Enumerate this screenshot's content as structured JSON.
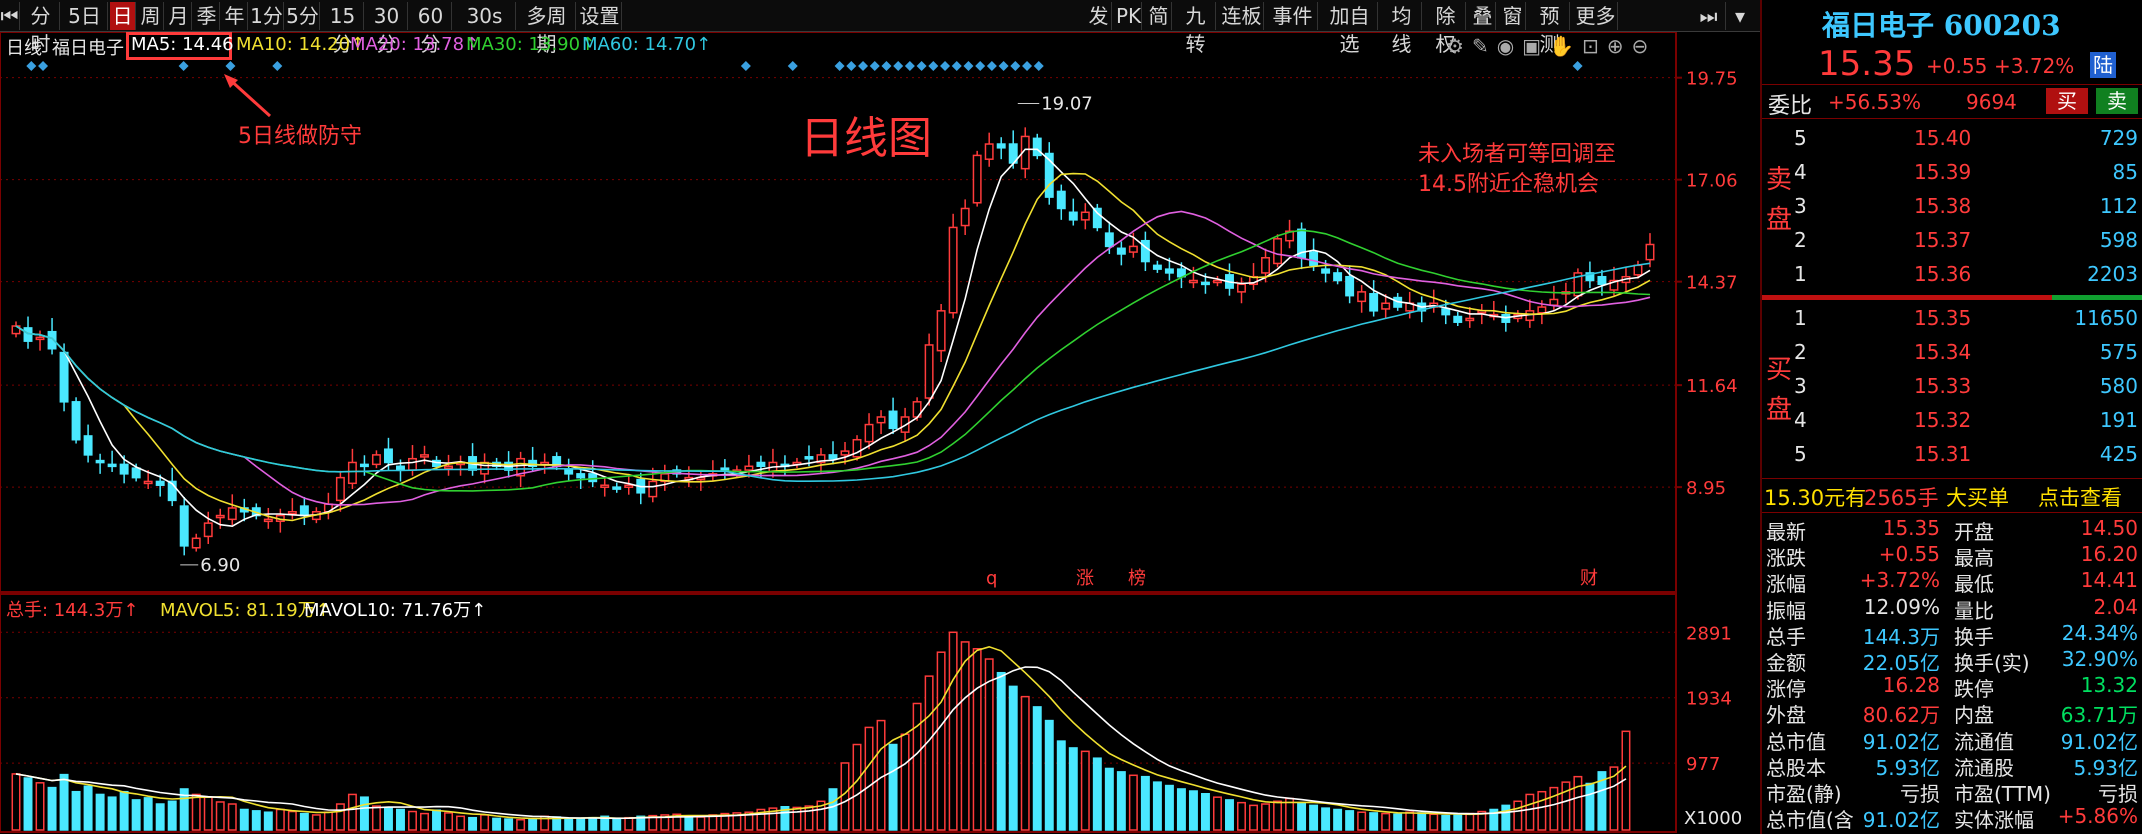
{
  "toolbar": {
    "left_items": [
      "分时",
      "5日",
      "日",
      "周",
      "月",
      "季",
      "年",
      "1分",
      "5分",
      "15分",
      "30分",
      "60分",
      "30s",
      "多周期",
      "设置"
    ],
    "active_item": "日",
    "right_items": [
      "发",
      "PK",
      "简",
      "九转",
      "连板",
      "事件",
      "加自选",
      "均线",
      "除权",
      "叠",
      "窗",
      "预测",
      "更多"
    ]
  },
  "legend": {
    "period": "日线",
    "stock": "福日电子",
    "ma5": "MA5: 14.46",
    "ma10": "MA10: 14.20↑",
    "ma20": "MA20: 13.78↑",
    "ma30": "MA30: 13.90↑",
    "ma60": "MA60: 14.70↑"
  },
  "annotations": {
    "ma5_note": "5日线做防守",
    "chart_title": "日线图",
    "note_line1": "未入场者可等回调至",
    "note_line2": "14.5附近企稳机会",
    "high_label": "19.07",
    "low_label": "6.90",
    "event_q": "q",
    "event_zhang": "涨",
    "event_bang": "榜",
    "event_cai": "财"
  },
  "volume_legend": {
    "total": "总手: 144.3万↑",
    "mavol5": "MAVOL5: 81.19万↑",
    "mavol10": "MAVOL10: 71.76万↑",
    "unit": "X1000"
  },
  "colors": {
    "up": "#ff3b3b",
    "down": "#4ae8ff",
    "ma5": "#ffffff",
    "ma10": "#f0e030",
    "ma20": "#e060e0",
    "ma30": "#30d030",
    "ma60": "#30c8e0",
    "background": "#000000",
    "grid": "#7a0000"
  },
  "chart_data": {
    "type": "candlestick",
    "price_axis_ticks": [
      "19.75",
      "17.06",
      "14.37",
      "11.64",
      "8.95"
    ],
    "volume_axis_ticks": [
      "2891",
      "1934",
      "977"
    ],
    "price_range": [
      6.5,
      19.9
    ],
    "volume_range": [
      0,
      3100
    ],
    "high": 19.07,
    "low": 6.9,
    "close_series": [
      13.2,
      12.8,
      12.9,
      12.6,
      11.2,
      10.2,
      9.8,
      9.6,
      9.5,
      9.3,
      9.2,
      9.1,
      9.0,
      8.6,
      7.4,
      7.6,
      8.0,
      8.2,
      8.4,
      8.3,
      8.2,
      8.1,
      8.2,
      8.3,
      8.2,
      8.3,
      8.5,
      9.2,
      9.6,
      9.5,
      9.8,
      9.6,
      9.4,
      9.7,
      9.8,
      9.5,
      9.5,
      9.6,
      9.4,
      9.6,
      9.5,
      9.4,
      9.7,
      9.5,
      9.6,
      9.5,
      9.3,
      9.2,
      9.1,
      9.0,
      8.9,
      9.0,
      8.8,
      9.1,
      9.3,
      9.3,
      9.2,
      9.2,
      9.3,
      9.4,
      9.4,
      9.5,
      9.5,
      9.6,
      9.5,
      9.6,
      9.7,
      9.8,
      9.7,
      9.9,
      10.2,
      10.6,
      10.8,
      10.5,
      10.8,
      11.2,
      12.7,
      13.6,
      15.8,
      16.3,
      17.7,
      18.0,
      17.9,
      17.5,
      18.2,
      17.7,
      16.6,
      16.3,
      16.0,
      16.2,
      15.8,
      15.3,
      15.1,
      15.3,
      14.9,
      14.7,
      14.6,
      14.5,
      14.4,
      14.3,
      14.4,
      14.2,
      14.3,
      14.5,
      15.0,
      15.5,
      15.7,
      15.0,
      14.8,
      14.6,
      14.4,
      14.0,
      14.1,
      13.6,
      13.8,
      13.7,
      13.8,
      13.6,
      13.8,
      13.5,
      13.3,
      13.4,
      13.6,
      13.5,
      13.3,
      13.5,
      13.6,
      13.7,
      13.9,
      14.1,
      14.6,
      14.4,
      14.3,
      14.4,
      14.5,
      14.8,
      15.35
    ],
    "volume_series": [
      820,
      760,
      690,
      620,
      810,
      560,
      640,
      520,
      480,
      560,
      440,
      470,
      380,
      420,
      600,
      520,
      480,
      410,
      380,
      300,
      280,
      260,
      300,
      270,
      240,
      220,
      260,
      380,
      520,
      480,
      350,
      330,
      300,
      270,
      240,
      290,
      250,
      200,
      180,
      220,
      170,
      160,
      150,
      150,
      200,
      190,
      170,
      160,
      180,
      200,
      150,
      180,
      200,
      210,
      220,
      230,
      200,
      190,
      220,
      240,
      250,
      260,
      300,
      320,
      340,
      330,
      350,
      420,
      600,
      980,
      1250,
      1500,
      1600,
      1250,
      1400,
      1850,
      2250,
      2600,
      2891,
      2750,
      2650,
      2500,
      2300,
      2100,
      1950,
      1800,
      1600,
      1300,
      1200,
      1150,
      1050,
      900,
      850,
      800,
      780,
      700,
      650,
      600,
      570,
      530,
      480,
      440,
      400,
      360,
      380,
      420,
      460,
      400,
      360,
      320,
      300,
      280,
      260,
      250,
      240,
      230,
      260,
      250,
      230,
      210,
      220,
      240,
      270,
      300,
      360,
      420,
      520,
      560,
      620,
      700,
      780,
      680,
      850,
      920,
      1443
    ],
    "ma_last": {
      "MA5": 14.46,
      "MA10": 14.2,
      "MA20": 13.78,
      "MA30": 13.9,
      "MA60": 14.7
    }
  },
  "quote": {
    "title": "福日电子 600203",
    "price": "15.35",
    "change": "+0.55",
    "change_pct": "+3.72%",
    "tag": "陆",
    "weibi_label": "委比",
    "weibi": "+56.53%",
    "weicha": "9694",
    "buy_btn": "买",
    "sell_btn": "卖",
    "sell_label": "卖盘",
    "buy_label": "买盘",
    "asks": [
      {
        "level": "5",
        "price": "15.40",
        "vol": "729"
      },
      {
        "level": "4",
        "price": "15.39",
        "vol": "85"
      },
      {
        "level": "3",
        "price": "15.38",
        "vol": "112"
      },
      {
        "level": "2",
        "price": "15.37",
        "vol": "598"
      },
      {
        "level": "1",
        "price": "15.36",
        "vol": "2203"
      }
    ],
    "bids": [
      {
        "level": "1",
        "price": "15.35",
        "vol": "11650"
      },
      {
        "level": "2",
        "price": "15.34",
        "vol": "575"
      },
      {
        "level": "3",
        "price": "15.33",
        "vol": "580"
      },
      {
        "level": "4",
        "price": "15.32",
        "vol": "191"
      },
      {
        "level": "5",
        "price": "15.31",
        "vol": "425"
      }
    ],
    "bigorder_price": "15.30元有",
    "bigorder_vol": "2565手",
    "bigorder_text": "大买单",
    "bigorder_link": "点击查看",
    "stats": [
      {
        "l1": "最新",
        "v1": "15.35",
        "c1": "red",
        "l2": "开盘",
        "v2": "14.50",
        "c2": "red"
      },
      {
        "l1": "涨跌",
        "v1": "+0.55",
        "c1": "red",
        "l2": "最高",
        "v2": "16.20",
        "c2": "red"
      },
      {
        "l1": "涨幅",
        "v1": "+3.72%",
        "c1": "red",
        "l2": "最低",
        "v2": "14.41",
        "c2": "red"
      },
      {
        "l1": "振幅",
        "v1": "12.09%",
        "c1": "white",
        "l2": "量比",
        "v2": "2.04",
        "c2": "red"
      },
      {
        "l1": "总手",
        "v1": "144.3万",
        "c1": "cyan",
        "l2": "换手",
        "v2": "24.34%",
        "c2": "cyan"
      },
      {
        "l1": "金额",
        "v1": "22.05亿",
        "c1": "cyan",
        "l2": "换手(实)",
        "v2": "32.90%",
        "c2": "cyan"
      },
      {
        "l1": "涨停",
        "v1": "16.28",
        "c1": "red",
        "l2": "跌停",
        "v2": "13.32",
        "c2": "green"
      },
      {
        "l1": "外盘",
        "v1": "80.62万",
        "c1": "red",
        "l2": "内盘",
        "v2": "63.71万",
        "c2": "green"
      },
      {
        "l1": "总市值",
        "v1": "91.02亿",
        "c1": "cyan",
        "l2": "流通值",
        "v2": "91.02亿",
        "c2": "cyan"
      },
      {
        "l1": "总股本",
        "v1": "5.93亿",
        "c1": "cyan",
        "l2": "流通股",
        "v2": "5.93亿",
        "c2": "cyan"
      },
      {
        "l1": "市盈(静)",
        "v1": "亏损",
        "c1": "white",
        "l2": "市盈(TTM)",
        "v2": "亏损",
        "c2": "white"
      },
      {
        "l1": "总市值(含",
        "v1": "91.02亿",
        "c1": "cyan",
        "l2": "实体涨幅",
        "v2": "+5.86%",
        "c2": "red"
      }
    ]
  }
}
